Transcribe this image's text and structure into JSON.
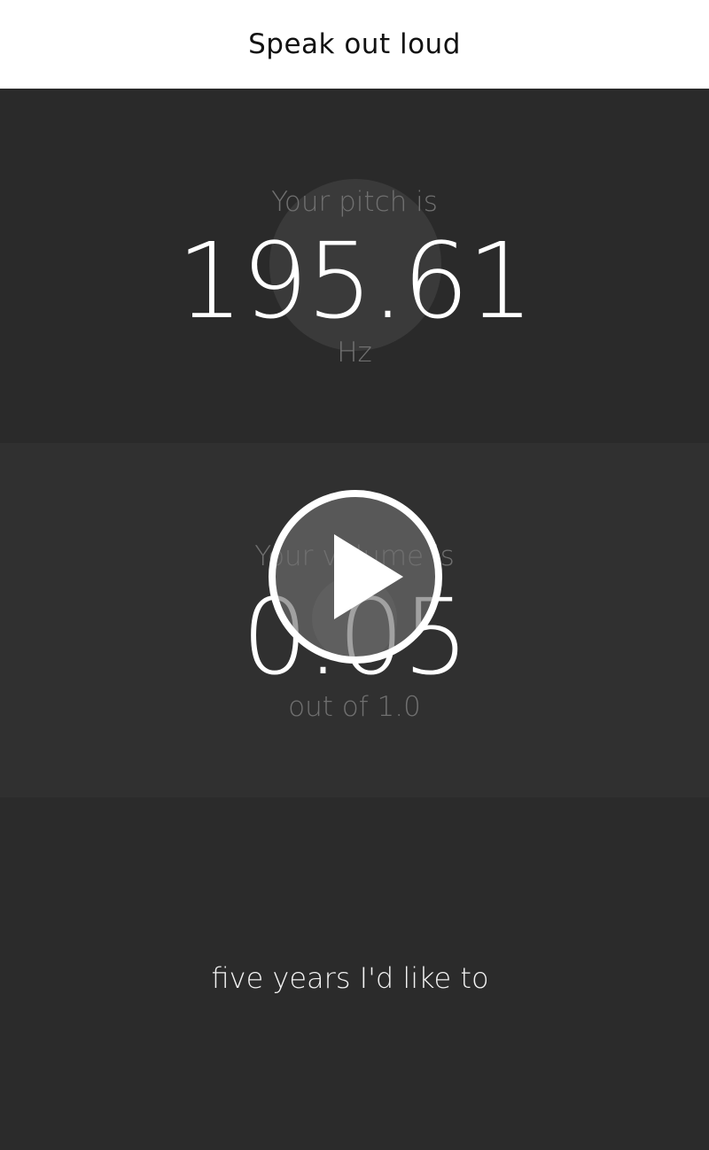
{
  "header": {
    "title": "Speak out loud"
  },
  "pitch": {
    "label": "Your pitch is",
    "value": "195.61",
    "unit": "Hz"
  },
  "volume": {
    "label": "Your volume is",
    "value": "0.05",
    "unit": "out of 1.0"
  },
  "player": {
    "icon": "play-icon"
  },
  "transcript": {
    "text": "five years I'd like to"
  }
}
